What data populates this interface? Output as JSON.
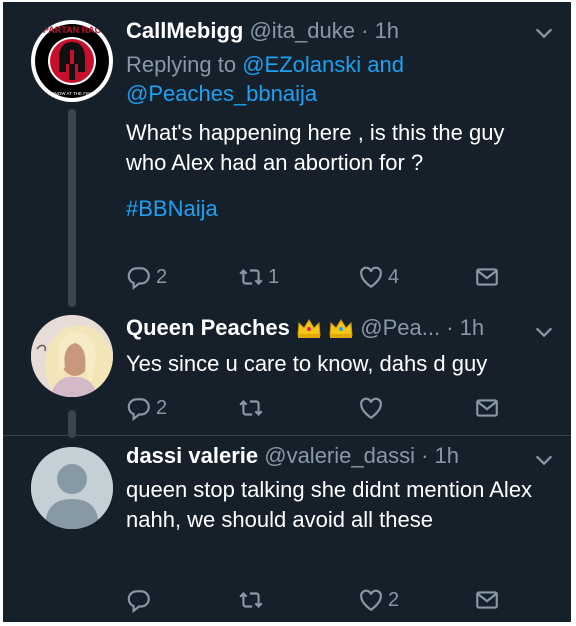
{
  "tweets": [
    {
      "display_name": "CallMebigg",
      "handle": "@ita_duke",
      "separator": "·",
      "time": "1h",
      "replying_prefix": "Replying to",
      "reply_to_1": "@EZolanski",
      "reply_joiner": "and",
      "reply_to_2": "@Peaches_bbnaija",
      "text": "What's happening here , is this the guy who Alex had an abortion for ?",
      "hashtag": "#BBNaija",
      "reply_count": "2",
      "retweet_count": "1",
      "like_count": "4",
      "avatar_logo_text": "SPARTAN RACE",
      "avatar_logo_subtext": "YOU'LL KNOW AT THE FINISH LINE"
    },
    {
      "display_name": "Queen Peaches",
      "handle": "@Pea...",
      "separator": "·",
      "time": "1h",
      "text": "Yes since u care to know, dahs d guy",
      "reply_count": "2",
      "retweet_count": "",
      "like_count": ""
    },
    {
      "display_name": "dassi valerie",
      "handle": "@valerie_dassi",
      "separator": "·",
      "time": "1h",
      "text": "queen stop talking she didnt mention Alex nahh, we should avoid all these",
      "reply_count": "",
      "retweet_count": "",
      "like_count": "2"
    }
  ],
  "colors": {
    "background": "#15202b",
    "text": "#ffffff",
    "muted": "#8899a6",
    "accent": "#1da1f2",
    "thread_line": "#38444d"
  },
  "icons": [
    "reply-icon",
    "retweet-icon",
    "like-icon",
    "share-icon",
    "chevron-down-icon",
    "crown-icon"
  ]
}
